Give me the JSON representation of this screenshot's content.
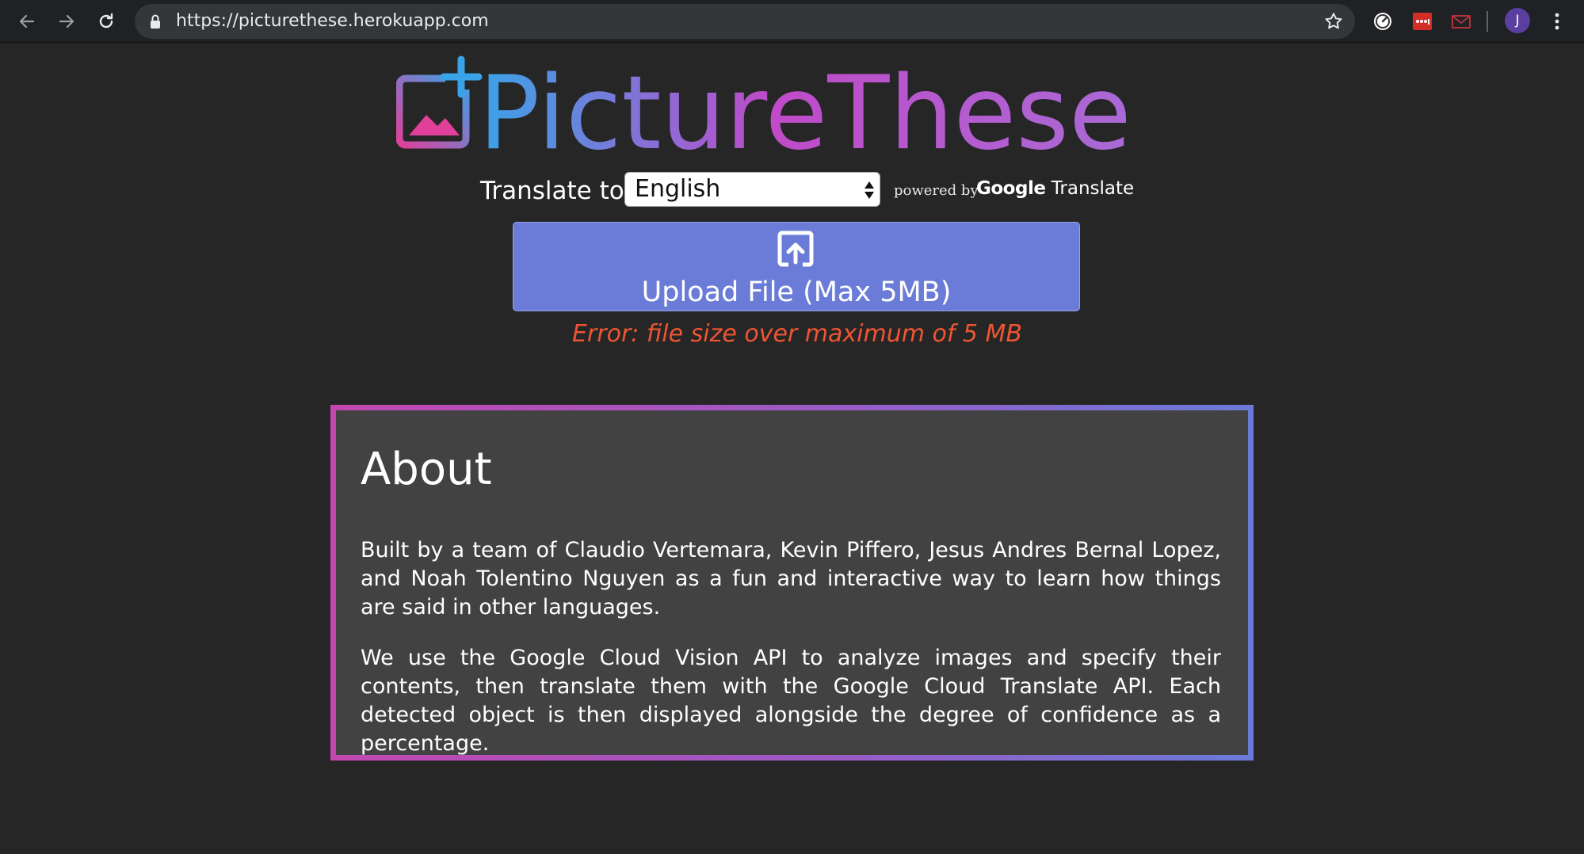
{
  "browser": {
    "url": "https://picturethese.herokuapp.com",
    "avatar_initial": "J",
    "icons": [
      "back-arrow-icon",
      "forward-arrow-icon",
      "reload-icon",
      "lock-icon",
      "star-icon",
      "speedometer-extension-icon",
      "lastpass-extension-icon",
      "mail-extension-icon",
      "more-menu-icon"
    ]
  },
  "logo": {
    "text": "PictureThese",
    "gradient_start": "#3aa3e8",
    "gradient_mid": "#c04ac8",
    "gradient_end": "#d84a9e"
  },
  "translate": {
    "label": "Translate to",
    "selected_language": "English",
    "powered_by": "powered by",
    "google": "Google",
    "translate_word": "Translate"
  },
  "upload": {
    "label": "Upload File (Max 5MB)",
    "color": "#6a7cd8"
  },
  "error": {
    "message": "Error: file size over maximum of 5 MB",
    "color": "#ee5533"
  },
  "about": {
    "title": "About",
    "paragraph1": "Built by a team of Claudio Vertemara, Kevin Piffero, Jesus Andres Bernal Lopez, and Noah Tolentino Nguyen as a fun and interactive way to learn how things are said in other languages.",
    "paragraph2": "We use the Google Cloud Vision API to analyze images and specify their contents, then translate them with the Google Cloud Translate API. Each detected object is then displayed alongside the degree of confidence as a percentage."
  }
}
